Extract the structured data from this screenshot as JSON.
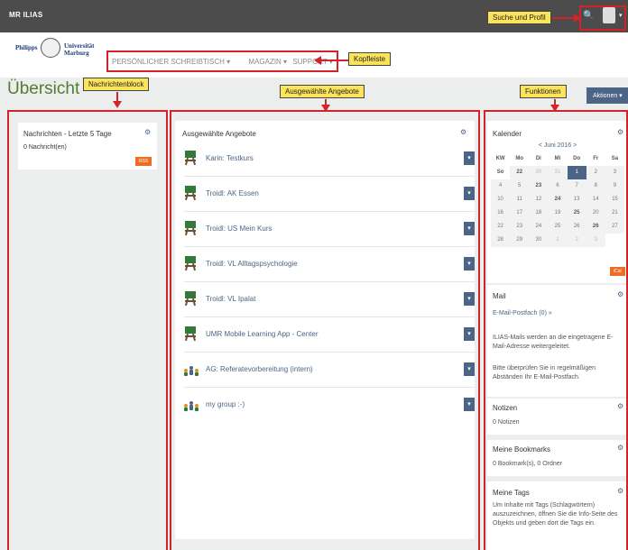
{
  "topbar": {
    "brand": "MR ILIAS",
    "search_icon": "search-icon",
    "profile_icon": "user-avatar-icon"
  },
  "logo": {
    "left": "Philipps",
    "right_line1": "Universität",
    "right_line2": "Marburg"
  },
  "mainnav": {
    "items": [
      "PERSÖNLICHER SCHREIBTISCH ▾",
      "MAGAZIN ▾",
      "SUPPORT ▾"
    ]
  },
  "page": {
    "title": "Übersicht",
    "actions_label": "Aktionen ▾"
  },
  "news": {
    "title": "Nachrichten - Letzte 5 Tage",
    "count": "0 Nachricht(en)",
    "rss": "RSS"
  },
  "selected": {
    "title": "Ausgewählte Angebote",
    "items": [
      {
        "label": "Karin: Testkurs",
        "type": "course"
      },
      {
        "label": "Troidl: AK Essen",
        "type": "course"
      },
      {
        "label": "Troidl: US Mein Kurs",
        "type": "course"
      },
      {
        "label": "Troidl: VL Alltagspsychologie",
        "type": "course"
      },
      {
        "label": "Troidl: VL Ipalat",
        "type": "course"
      },
      {
        "label": "UMR Mobile Learning App - Center",
        "type": "course"
      },
      {
        "label": "AG: Referatevorbereitung (intern)",
        "type": "group"
      },
      {
        "label": "my group :-)",
        "type": "group"
      }
    ]
  },
  "calendar": {
    "title": "Kalender",
    "month": "< Juni 2016 >",
    "headers": [
      "KW",
      "Mo",
      "Di",
      "Mi",
      "Do",
      "Fr",
      "Sa",
      "So"
    ],
    "rows": [
      [
        "22",
        "30",
        "31",
        "1",
        "2",
        "3",
        "4",
        "5"
      ],
      [
        "23",
        "6",
        "7",
        "8",
        "9",
        "10",
        "11",
        "12"
      ],
      [
        "24",
        "13",
        "14",
        "15",
        "16",
        "17",
        "18",
        "19"
      ],
      [
        "25",
        "20",
        "21",
        "22",
        "23",
        "24",
        "25",
        "26"
      ],
      [
        "26",
        "27",
        "28",
        "29",
        "30",
        "1",
        "2",
        "3"
      ]
    ],
    "today": "1",
    "ical": "iCal"
  },
  "mail": {
    "title": "Mail",
    "link": "E-Mail-Postfach (0) »",
    "text1": "ILIAS-Mails werden an die eingetragene E-Mail-Adresse weitergeleitet.",
    "text2": "Bitte überprüfen Sie in regelmäßigen Abständen Ihr E-Mail-Postfach."
  },
  "notes": {
    "title": "Notizen",
    "count": "0 Notizen"
  },
  "bookmarks": {
    "title": "Meine Bookmarks",
    "count": "0 Bookmark(s), 0 Ordner"
  },
  "tags": {
    "title": "Meine Tags",
    "text": "Um Inhalte mit Tags (Schlagwörtern) auszuzeichnen, öffnen Sie die Info-Seite des Objekts und geben dort die Tags ein."
  },
  "callouts": {
    "search_profile": "Suche und Profil",
    "header": "Kopfleiste",
    "news": "Nachrichtenblock",
    "selected": "Ausgewählte Angebote",
    "functions": "Funktionen"
  },
  "colors": {
    "accent": "#4c6586",
    "title_green": "#557b2e",
    "callout_border": "#d2232a",
    "callout_fill": "#fce45a",
    "rss_orange": "#ee6d22"
  }
}
